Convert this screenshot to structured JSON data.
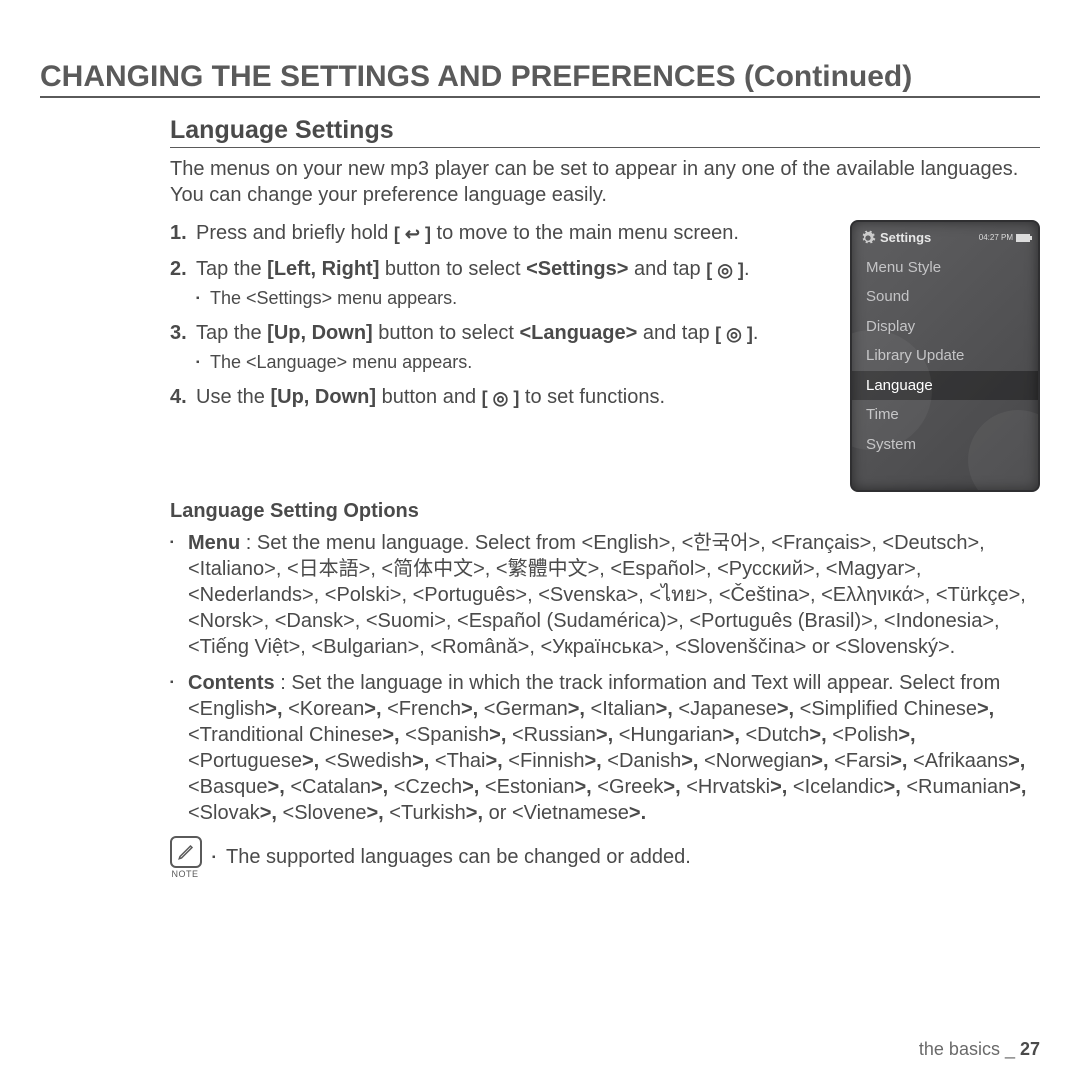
{
  "heading": "CHANGING THE SETTINGS AND PREFERENCES (Continued)",
  "section": "Language Settings",
  "intro": "The menus on your new mp3 player can be set to appear in any one of the available languages. You can change your preference language easily.",
  "steps": {
    "s1a": "Press and briefly hold ",
    "s1b": " to move to the main menu screen.",
    "s2a": "Tap the ",
    "s2b": "[Left, Right]",
    "s2c": " button to select ",
    "s2d": "<Settings>",
    "s2e": " and tap ",
    "s2sub": "The <Settings> menu appears.",
    "s3a": "Tap the ",
    "s3b": "[Up, Down]",
    "s3c": " button to select ",
    "s3d": "<Language>",
    "s3e": " and tap ",
    "s3sub": "The <Language> menu appears.",
    "s4a": "Use the ",
    "s4b": "[Up, Down]",
    "s4c": " button and ",
    "s4d": " to set functions."
  },
  "icons": {
    "back": "[ ↩ ]",
    "circle": "[ ◎ ]",
    "dot": "."
  },
  "subheading": "Language Setting Options",
  "options": {
    "menu_label": "Menu",
    "menu_text": " : Set the menu language. Select from <English>, <한국어>, <Français>, <Deutsch>, <Italiano>, <日本語>, <简体中文>, <繁體中文>, <Español>, <Русский>, <Magyar>, <Nederlands>, <Polski>, <Português>, <Svenska>, <ไทย>, <Čeština>, <Ελληνικά>, <Türkçe>, <Norsk>, <Dansk>, <Suomi>, <Español (Sudamérica)>, <Português (Brasil)>, <Indonesia>, <Tiếng Việt>, <Bulgarian>, <Română>, <Українська>, <Slovenščina> or <Slovenský>.",
    "contents_label": "Contents",
    "contents_text_a": " : Set the language in which the track information and Text will appear. Select from <English",
    "contents_text_b": " <Korean",
    "contents_text_c": " <French",
    "contents_text_d": " <German",
    "contents_text_e": "  <Italian",
    "contents_text_f": "  <Japanese",
    "contents_text_g": " <Simplified Chinese",
    "contents_text_h": " <Tranditional Chinese",
    "contents_text_i": "  <Spanish",
    "contents_text_j": "  <Russian",
    "contents_text_k": " <Hungarian",
    "contents_text_l": " <Dutch",
    "contents_text_m": " <Polish",
    "contents_text_n": " <Portuguese",
    "contents_text_o": " <Swedish",
    "contents_text_p": "  <Thai",
    "contents_text_q": " <Finnish",
    "contents_text_r": " <Danish",
    "contents_text_s": " <Norwegian",
    "contents_text_t": " <Farsi",
    "contents_text_u": " <Afrikaans",
    "contents_text_v": " <Basque",
    "contents_text_w": " <Catalan",
    "contents_text_x": " <Czech",
    "contents_text_y": " <Estonian",
    "contents_text_z": " <Greek",
    "contents_text_aa": " <Hrvatski",
    "contents_text_ab": " <Icelandic",
    "contents_text_ac": " <Rumanian",
    "contents_text_ad": " <Slovak",
    "contents_text_ae": " <Slovene",
    "contents_text_af": " <Turkish",
    "contents_text_ag": " or <Vietnamese",
    "bold_sep": ">,",
    "bold_end": ">"
  },
  "note": {
    "label": "NOTE",
    "text": "The supported languages can be changed or added."
  },
  "footer": {
    "section": "the basics _ ",
    "page": "27"
  },
  "device": {
    "title": "Settings",
    "clock": "04:27 PM",
    "items": [
      "Menu Style",
      "Sound",
      "Display",
      "Library Update",
      "Language",
      "Time",
      "System"
    ],
    "selected_index": 4
  }
}
